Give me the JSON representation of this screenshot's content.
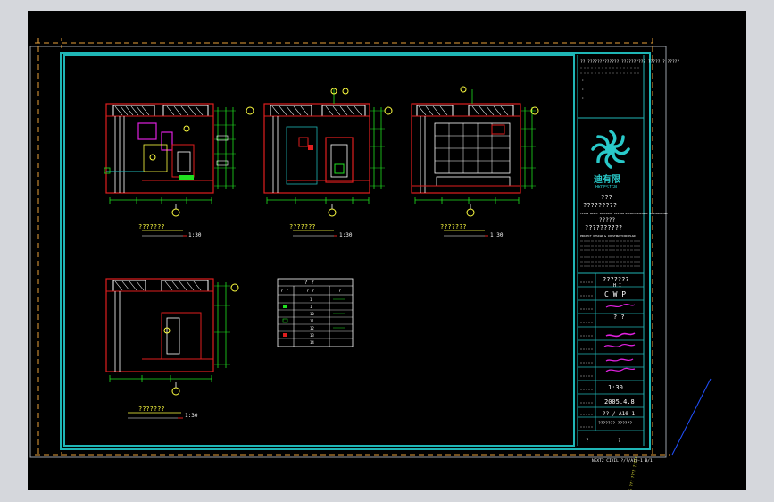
{
  "colors": {
    "background": "#000000",
    "viewport_frame": "#d5d7dc",
    "border_cyan": "#1fb6b6",
    "dashed_orange": "#e8a13a",
    "wall_red": "#e01e1e",
    "dim_green": "#20e020",
    "annot_white": "#ffffff",
    "label_yellow": "#ffff40",
    "accent_magenta": "#e020e0",
    "logo_cyan": "#29c9c9"
  },
  "elevations": [
    {
      "title": "???????",
      "scale": "1:30",
      "number": "Ⓐ"
    },
    {
      "title": "???????",
      "scale": "1:30",
      "number": "Ⓑ"
    },
    {
      "title": "???????",
      "scale": "1:30",
      "number": "Ⓒ"
    },
    {
      "title": "???????",
      "scale": "1:30",
      "number": "Ⓓ"
    }
  ],
  "legend_table": {
    "header_top": "?    ?",
    "header_cols": [
      "? ?",
      "? ?",
      "?"
    ],
    "rows": [
      "1",
      "1",
      "10",
      "11",
      "12",
      "13",
      "14",
      "15"
    ]
  },
  "title_block": {
    "top_notes": "?? ?????????????  ??????????  ????? ? ?????",
    "logo_text": "迪有限",
    "logo_sub": "HKDESIGN",
    "company_cn": "???",
    "company_cn2": "?????????",
    "company_en": "CEJAN RUIEI INTERIOR DESIGN & PROFESSIONAL ENGINEERING",
    "company_cn3": "?????",
    "project_cn": "??????????",
    "project_en": "PROJECT DESIGN & CONSTRUCTION PLAN",
    "drawing_title": "???????",
    "drawing_title2": "H I",
    "code_letters": "C  W  P",
    "design_marks": "?    ?",
    "scale_value": "1:30",
    "date_value": "2005.4.8",
    "sheet_no": "?? / A10-1",
    "notes": "??????? ??????",
    "footer_labels": [
      "?",
      "?"
    ]
  },
  "status_text": "NEXT2 CIVIL ?/?/A10-1 B/1",
  "rotated_note": "?? ??? ???? ?????"
}
